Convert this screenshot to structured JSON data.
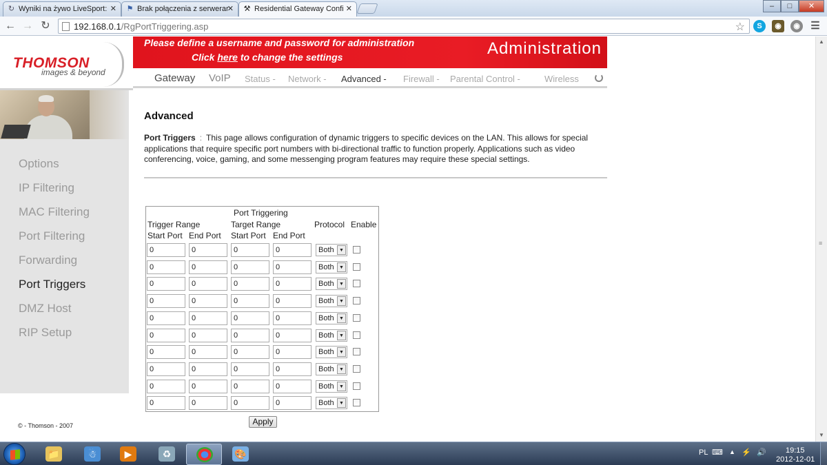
{
  "browser": {
    "tabs": [
      {
        "title": "Wyniki na żywo LiveSport:",
        "icon": "refresh-icon"
      },
      {
        "title": "Brak połączenia z serwerar",
        "icon": "flag-icon"
      },
      {
        "title": "Residential Gateway Confi",
        "icon": "tools-icon"
      }
    ],
    "url_host": "192.168.0.1",
    "url_path": "/RgPortTriggering.asp",
    "window_controls": [
      "minimize",
      "maximize",
      "close"
    ]
  },
  "header": {
    "logo": "THOMSON",
    "logo_tagline": "images & beyond",
    "notice_line1": "Please define a username and password for administration",
    "notice_click": "Click",
    "notice_here": "here",
    "notice_rest": "to change the settings",
    "section_title": "Administration",
    "accent_color": "#e41b23"
  },
  "nav": {
    "gateway": "Gateway",
    "voip": "VoIP",
    "status": "Status -",
    "network": "Network -",
    "advanced": "Advanced -",
    "firewall": "Firewall -",
    "parental": "Parental Control -",
    "wireless": "Wireless"
  },
  "sidebar": {
    "items": [
      "Options",
      "IP Filtering",
      "MAC Filtering",
      "Port Filtering",
      "Forwarding",
      "Port Triggers",
      "DMZ Host",
      "RIP Setup"
    ],
    "active": "Port Triggers",
    "copyright": "© - Thomson - 2007"
  },
  "content": {
    "title": "Advanced",
    "section_label": "Port Triggers",
    "colon": ":",
    "description": "This page allows configuration of dynamic triggers to specific devices on the LAN. This allows for special applications that require specific port numbers with bi-directional traffic to function properly. Applications such as video conferencing, voice, gaming, and some messenging program features may require these special settings."
  },
  "table": {
    "title": "Port Triggering",
    "trigger_range": "Trigger Range",
    "target_range": "Target Range",
    "protocol": "Protocol",
    "enable": "Enable",
    "start_port": "Start Port",
    "end_port": "End Port",
    "rows": [
      {
        "trigger_start": "0",
        "trigger_end": "0",
        "target_start": "0",
        "target_end": "0",
        "protocol": "Both",
        "enabled": false
      },
      {
        "trigger_start": "0",
        "trigger_end": "0",
        "target_start": "0",
        "target_end": "0",
        "protocol": "Both",
        "enabled": false
      },
      {
        "trigger_start": "0",
        "trigger_end": "0",
        "target_start": "0",
        "target_end": "0",
        "protocol": "Both",
        "enabled": false
      },
      {
        "trigger_start": "0",
        "trigger_end": "0",
        "target_start": "0",
        "target_end": "0",
        "protocol": "Both",
        "enabled": false
      },
      {
        "trigger_start": "0",
        "trigger_end": "0",
        "target_start": "0",
        "target_end": "0",
        "protocol": "Both",
        "enabled": false
      },
      {
        "trigger_start": "0",
        "trigger_end": "0",
        "target_start": "0",
        "target_end": "0",
        "protocol": "Both",
        "enabled": false
      },
      {
        "trigger_start": "0",
        "trigger_end": "0",
        "target_start": "0",
        "target_end": "0",
        "protocol": "Both",
        "enabled": false
      },
      {
        "trigger_start": "0",
        "trigger_end": "0",
        "target_start": "0",
        "target_end": "0",
        "protocol": "Both",
        "enabled": false
      },
      {
        "trigger_start": "0",
        "trigger_end": "0",
        "target_start": "0",
        "target_end": "0",
        "protocol": "Both",
        "enabled": false
      },
      {
        "trigger_start": "0",
        "trigger_end": "0",
        "target_start": "0",
        "target_end": "0",
        "protocol": "Both",
        "enabled": false
      }
    ],
    "apply_label": "Apply"
  },
  "taskbar": {
    "apps": [
      "windows-explorer-icon",
      "network-icon",
      "media-player-icon",
      "recycle-icon",
      "chrome-icon",
      "paint-icon"
    ],
    "active_app": "chrome-icon",
    "language": "PL",
    "time": "19:15",
    "date": "2012-12-01"
  }
}
